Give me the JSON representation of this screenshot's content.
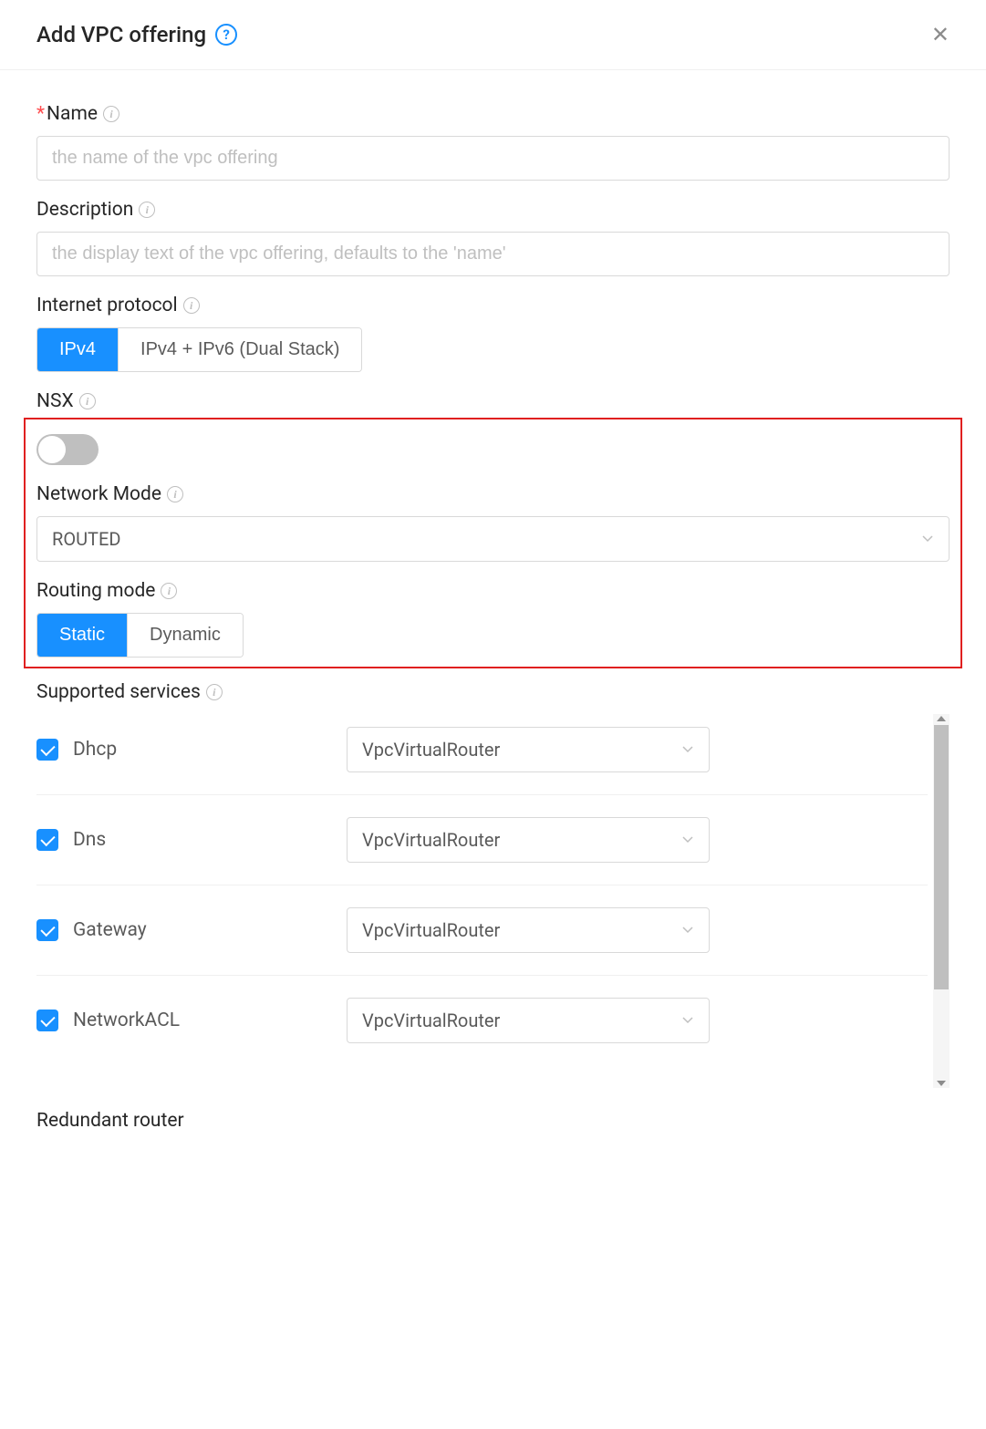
{
  "header": {
    "title": "Add VPC offering"
  },
  "form": {
    "name": {
      "label": "Name",
      "placeholder": "the name of the vpc offering",
      "required": true
    },
    "description": {
      "label": "Description",
      "placeholder": "the display text of the vpc offering, defaults to the 'name'"
    },
    "internetProtocol": {
      "label": "Internet protocol",
      "options": [
        "IPv4",
        "IPv4 + IPv6 (Dual Stack)"
      ],
      "selected": "IPv4"
    },
    "nsx": {
      "label": "NSX",
      "value": false
    },
    "networkMode": {
      "label": "Network Mode",
      "value": "ROUTED"
    },
    "routingMode": {
      "label": "Routing mode",
      "options": [
        "Static",
        "Dynamic"
      ],
      "selected": "Static"
    },
    "supportedServices": {
      "label": "Supported services",
      "items": [
        {
          "name": "Dhcp",
          "provider": "VpcVirtualRouter",
          "checked": true
        },
        {
          "name": "Dns",
          "provider": "VpcVirtualRouter",
          "checked": true
        },
        {
          "name": "Gateway",
          "provider": "VpcVirtualRouter",
          "checked": true
        },
        {
          "name": "NetworkACL",
          "provider": "VpcVirtualRouter",
          "checked": true
        }
      ]
    },
    "redundantRouter": {
      "label": "Redundant router"
    }
  }
}
